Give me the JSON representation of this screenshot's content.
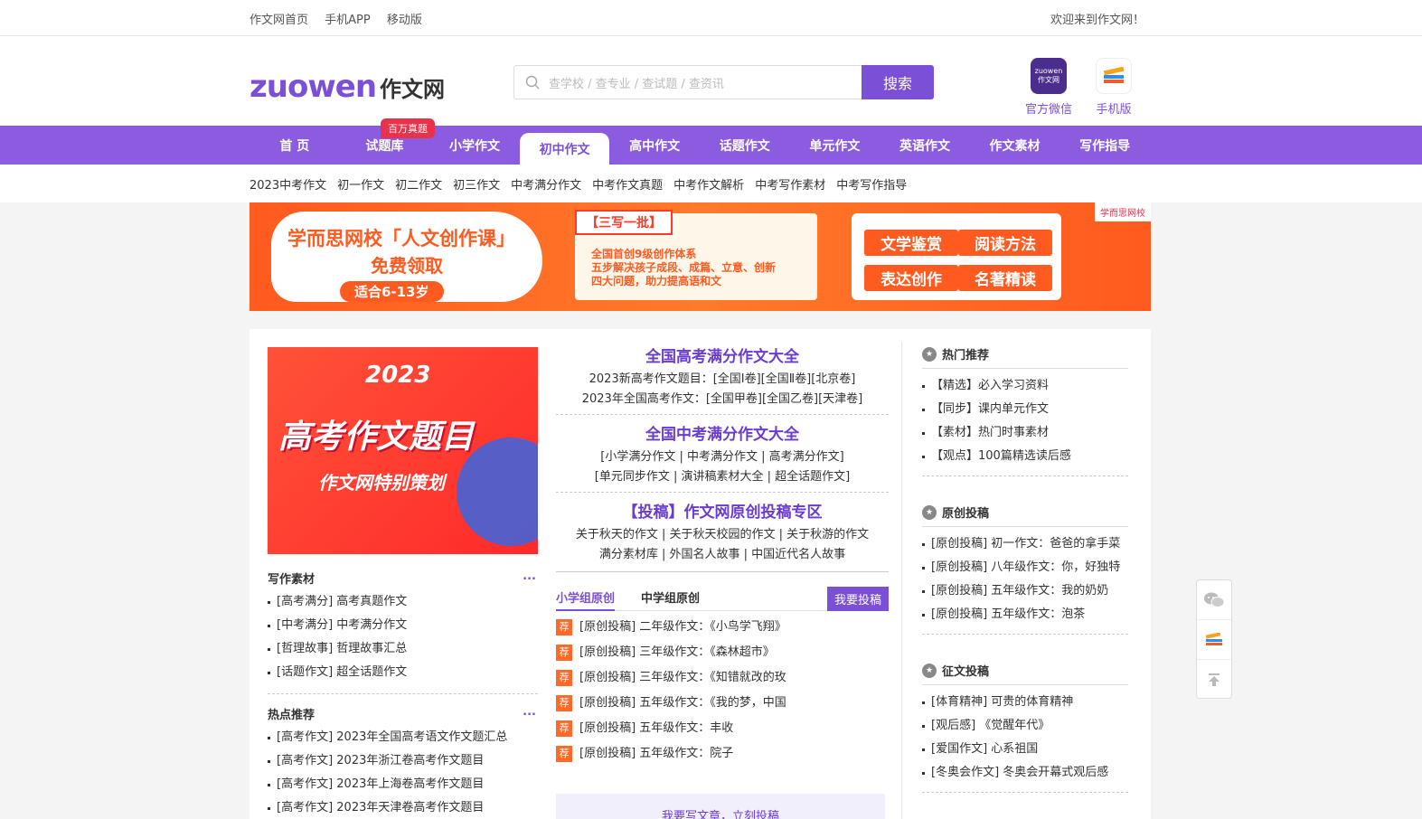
{
  "topbar": {
    "links": [
      "作文网首页",
      "手机APP",
      "移动版"
    ],
    "welcome": "欢迎来到作文网！"
  },
  "header": {
    "logo_en": "zuowen",
    "logo_cn": "作文网",
    "search_placeholder": "查学校 / 查专业 / 查试题 / 查资讯",
    "search_button": "搜索",
    "wechat_label": "官方微信",
    "wechat_icon_text": "zuowen\n作文网",
    "mobile_label": "手机版"
  },
  "nav": {
    "items": [
      "首 页",
      "试题库",
      "小学作文",
      "初中作文",
      "高中作文",
      "话题作文",
      "单元作文",
      "英语作文",
      "作文素材",
      "写作指导"
    ],
    "active_index": 3,
    "badge": "百万真题"
  },
  "subnav": [
    "2023中考作文",
    "初一作文",
    "初二作文",
    "初三作文",
    "中考满分作文",
    "中考作文真题",
    "中考作文解析",
    "中考写作素材",
    "中考写作指导"
  ],
  "banner": {
    "title1": "学而思网校「人文创作课」",
    "title2": "免费领取",
    "age": "适合6-13岁",
    "tag": "【三写一批】",
    "line1": "全国首创9级创作体系",
    "line2": "五步解决孩子成段、成篇、立意、创新",
    "line3": "四大问题，助力提高语和文",
    "grid": [
      "文学鉴赏",
      "阅读方法",
      "表达创作",
      "名著精读"
    ],
    "brand": "学而思网校"
  },
  "hero": {
    "year": "2023",
    "title": "高考作文题目",
    "subtitle": "作文网特别策划"
  },
  "writing_materials": {
    "title": "写作素材",
    "more": "...",
    "items": [
      "[高考满分] 高考真题作文",
      "[中考满分] 中考满分作文",
      "[哲理故事] 哲理故事汇总",
      "[话题作文] 超全话题作文"
    ]
  },
  "hot_topics": {
    "title": "热点推荐",
    "more": "...",
    "items": [
      "[高考作文] 2023年全国高考语文作文题汇总",
      "[高考作文] 2023年浙江卷高考作文题目",
      "[高考作文] 2023年上海卷高考作文题目",
      "[高考作文] 2023年天津卷高考作文题目"
    ]
  },
  "middle": {
    "b1_title": "全国高考满分作文大全",
    "b1_l1": "2023新高考作文题目：[全国Ⅰ卷][全国Ⅱ卷][北京卷]",
    "b1_l2": "2023年全国高考作文：[全国甲卷][全国乙卷][天津卷]",
    "b2_title": "全国中考满分作文大全",
    "b2_l1": "[小学满分作文 | 中考满分作文 | 高考满分作文]",
    "b2_l2": "[单元同步作文 | 演讲稿素材大全 | 超全话题作文]",
    "b3_title": "【投稿】作文网原创投稿专区",
    "b3_l1": "关于秋天的作文 | 关于秋天校园的作文 | 关于秋游的作文",
    "b3_l2": "满分素材库 | 外国名人故事 | 中国近代名人故事"
  },
  "original": {
    "tab1": "小学组原创",
    "tab2": "中学组原创",
    "submit": "我要投稿",
    "rec": "荐",
    "items": [
      "[原创投稿] 二年级作文：《小鸟学飞翔》",
      "[原创投稿] 三年级作文：《森林超市》",
      "[原创投稿] 三年级作文：《知错就改的玫",
      "[原创投稿] 五年级作文：《我的梦，中国",
      "[原创投稿] 五年级作文：丰收",
      "[原创投稿] 五年级作文：院子"
    ],
    "write_cta": "我要写文章，立刻投稿"
  },
  "right": {
    "hot": {
      "title": "热门推荐",
      "items": [
        "【精选】必入学习资料",
        "【同步】课内单元作文",
        "【素材】热门时事素材",
        "【观点】100篇精选读后感"
      ]
    },
    "orig": {
      "title": "原创投稿",
      "items": [
        "[原创投稿] 初一作文：爸爸的拿手菜",
        "[原创投稿] 八年级作文：你，好独特",
        "[原创投稿] 五年级作文：我的奶奶",
        "[原创投稿] 五年级作文：泡茶"
      ]
    },
    "contest": {
      "title": "征文投稿",
      "items": [
        "[体育精神] 可贵的体育精神",
        "[观后感] 《觉醒年代》",
        "[爱国作文] 心系祖国",
        "[冬奥会作文] 冬奥会开幕式观后感"
      ]
    }
  },
  "colors": {
    "brand": "#7b4fd6",
    "nav_bg": "#8c5ce0",
    "accent_orange": "#ff5a1f",
    "badge_red": "#e8314a"
  }
}
